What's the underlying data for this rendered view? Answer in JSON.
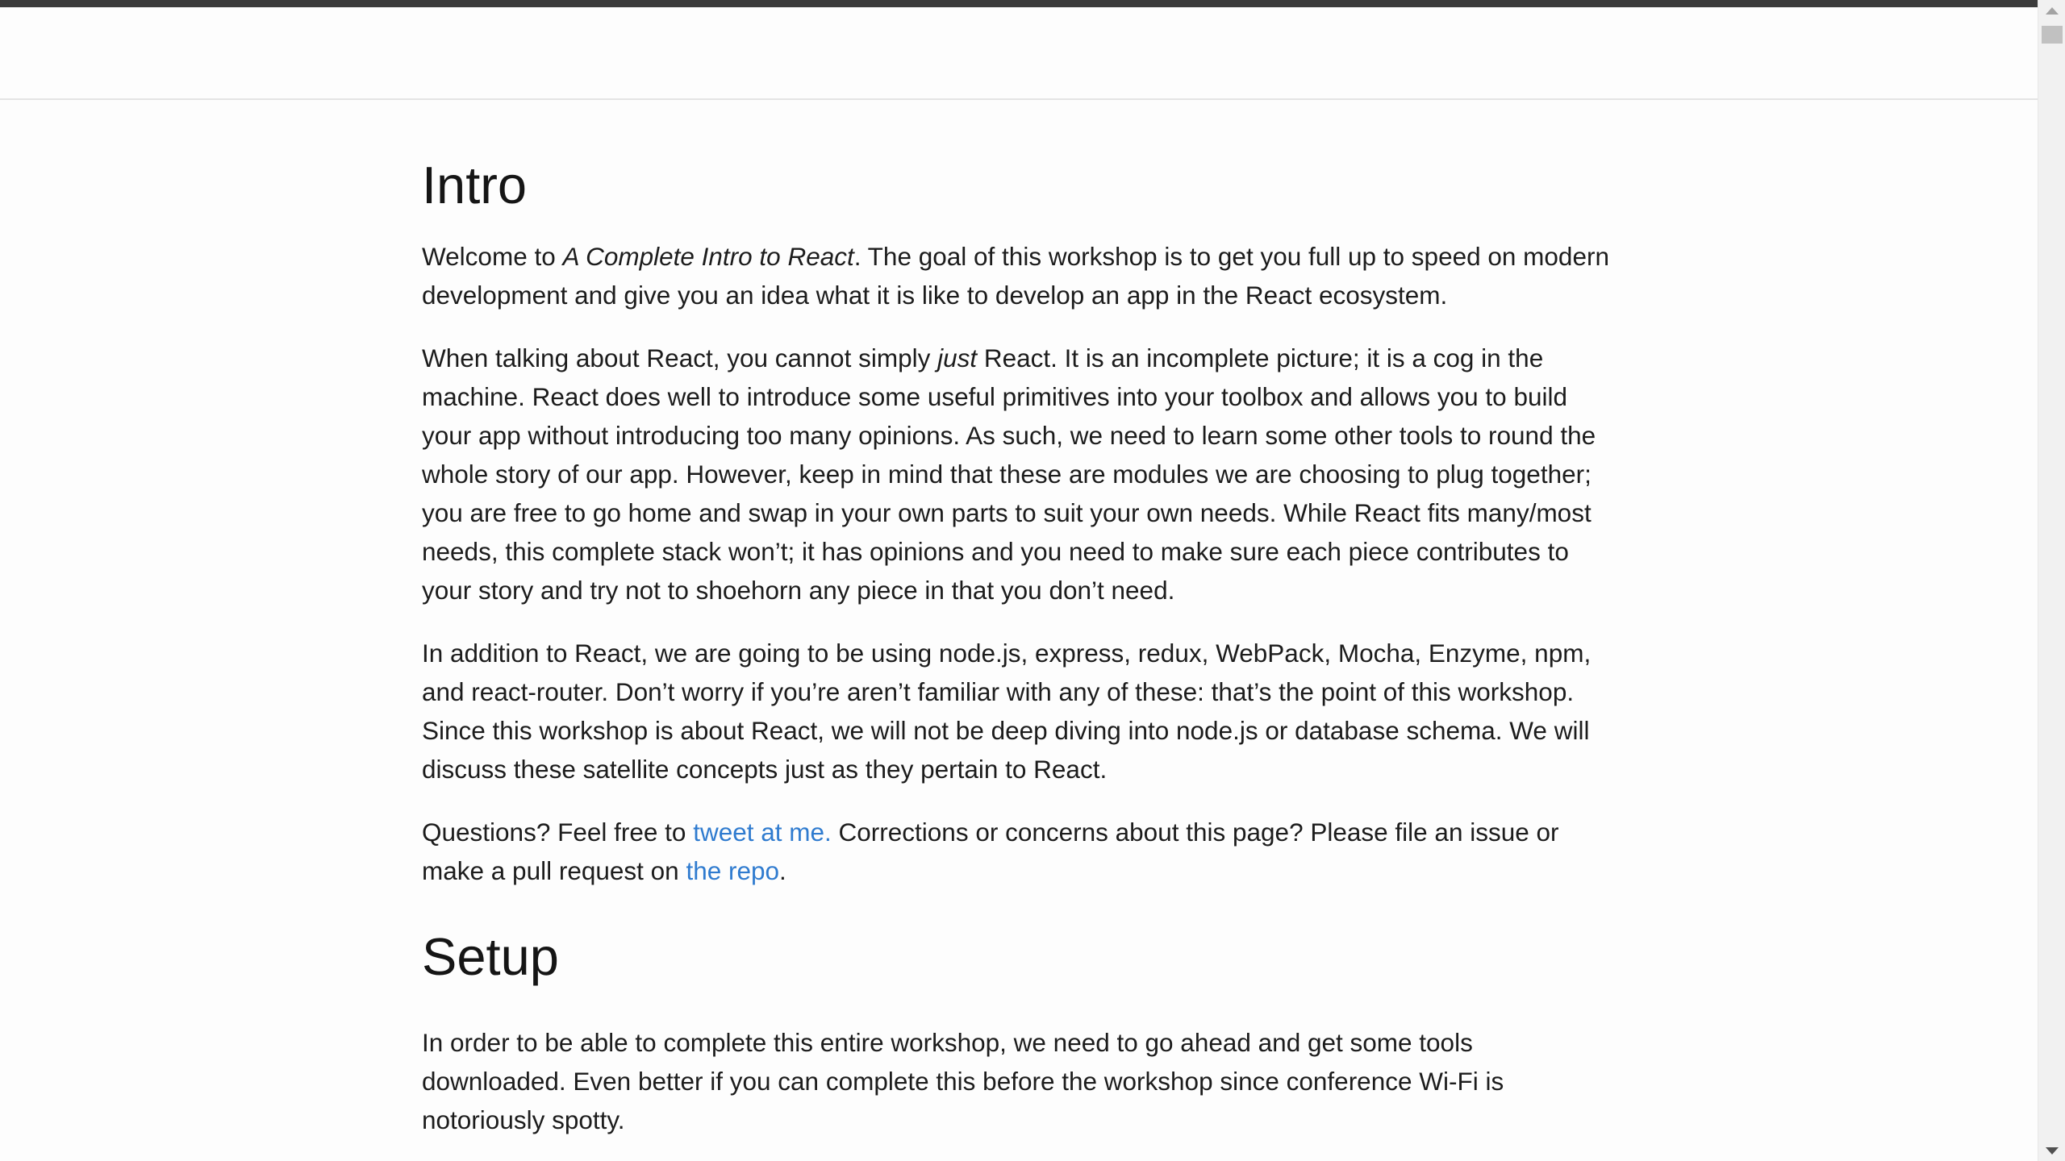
{
  "intro": {
    "heading": "Intro",
    "p1": {
      "before": "Welcome to ",
      "title": "A Complete Intro to React",
      "after": ". The goal of this workshop is to get you full up to speed on modern development and give you an idea what it is like to develop an app in the React ecosystem."
    },
    "p2": {
      "before": "When talking about React, you cannot simply ",
      "emphasis": "just",
      "after": " React. It is an incomplete picture; it is a cog in the machine. React does well to introduce some useful primitives into your toolbox and allows you to build your app without introducing too many opinions. As such, we need to learn some other tools to round the whole story of our app. However, keep in mind that these are modules we are choosing to plug together; you are free to go home and swap in your own parts to suit your own needs. While React fits many/most needs, this complete stack won’t; it has opinions and you need to make sure each piece contributes to your story and try not to shoehorn any piece in that you don’t need."
    },
    "p3": "In addition to React, we are going to be using node.js, express, redux, WebPack, Mocha, Enzyme, npm, and react-router. Don’t worry if you’re aren’t familiar with any of these: that’s the point of this workshop. Since this workshop is about React, we will not be deep diving into node.js or database schema. We will discuss these satellite concepts just as they pertain to React.",
    "p4": {
      "before": "Questions? Feel free to ",
      "tweet_link": "tweet at me.",
      "middle": " Corrections or concerns about this page? Please file an issue or make a pull request on ",
      "repo_link": "the repo",
      "after": "."
    }
  },
  "setup": {
    "heading": "Setup",
    "p1": "In order to be able to complete this entire workshop, we need to go ahead and get some tools downloaded. Even better if you can complete this before the workshop since conference Wi-Fi is notoriously spotty."
  },
  "colors": {
    "link": "#2f7bcf",
    "top_strip": "#3b3b3b",
    "background": "#fdfdfd"
  },
  "scrollbar": {
    "up_icon": "triangle-up",
    "down_icon": "triangle-down"
  }
}
